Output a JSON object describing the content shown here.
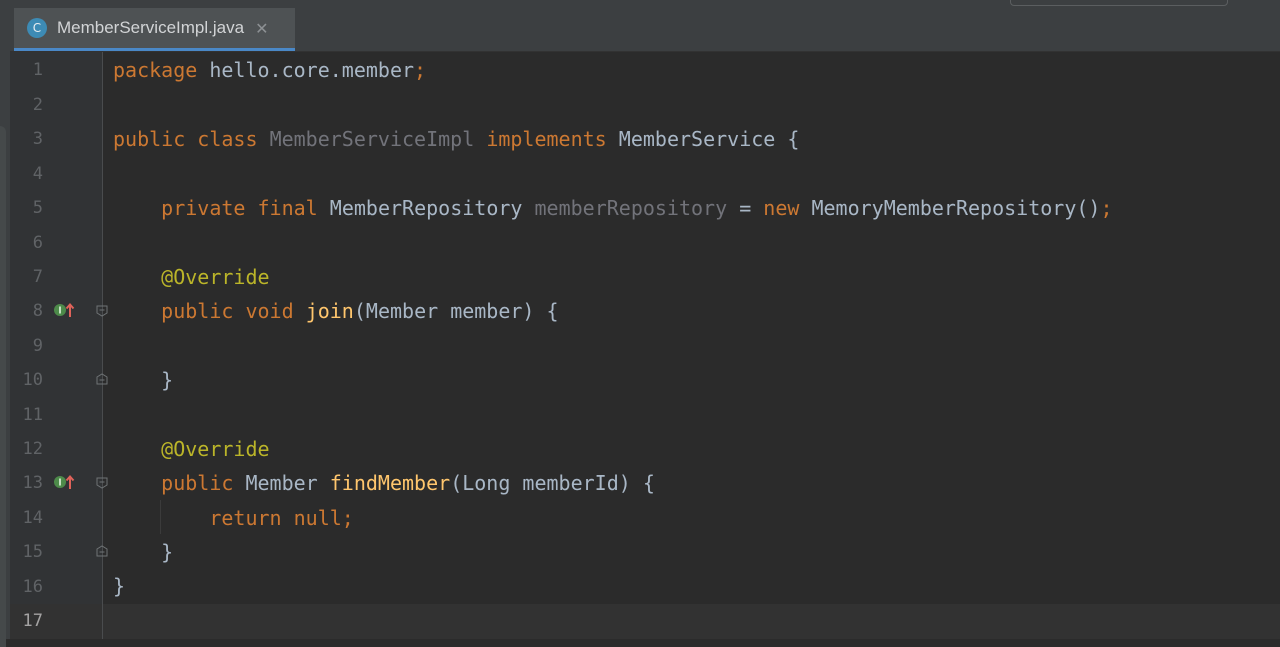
{
  "editor": {
    "tab": {
      "icon_letter": "C",
      "file_name": "MemberServiceImpl.java",
      "close_glyph": "✕"
    },
    "line_numbers": [
      "1",
      "2",
      "3",
      "4",
      "5",
      "6",
      "7",
      "8",
      "9",
      "10",
      "11",
      "12",
      "13",
      "14",
      "15",
      "16",
      "17"
    ],
    "current_line": "17",
    "code": {
      "l1": {
        "kw": "package",
        "rest": "hello.core.member",
        "semi": ";"
      },
      "l3": {
        "kw1": "public",
        "kw2": "class",
        "name": "MemberServiceImpl",
        "kw3": "implements",
        "iface": "MemberService",
        "brace": "{"
      },
      "l5": {
        "kw1": "private",
        "kw2": "final",
        "type": "MemberRepository",
        "field": "memberRepository",
        "eq": "=",
        "kw3": "new",
        "ctor": "MemoryMemberRepository()",
        "semi": ";"
      },
      "l7": {
        "ann": "@Override"
      },
      "l8": {
        "kw1": "public",
        "kw2": "void",
        "method": "join",
        "params": "(Member member) {"
      },
      "l10": {
        "brace": "}"
      },
      "l12": {
        "ann": "@Override"
      },
      "l13": {
        "kw1": "public",
        "type": "Member",
        "method": "findMember",
        "params": "(Long memberId) {"
      },
      "l14": {
        "kw": "return",
        "val": "null",
        "semi": ";"
      },
      "l15": {
        "brace": "}"
      },
      "l16": {
        "brace": "}"
      }
    }
  },
  "colors": {
    "background": "#2b2b2b",
    "keyword": "#cc7832",
    "annotation": "#bbb529",
    "method": "#ffc66d",
    "unused": "#72737a",
    "text": "#a9b7c6",
    "tab_underline": "#4a88c7"
  },
  "icons": {
    "tab_icon": "class-icon",
    "gutter_impl": "implements-method-icon",
    "gutter_fold": "fold-icon"
  }
}
